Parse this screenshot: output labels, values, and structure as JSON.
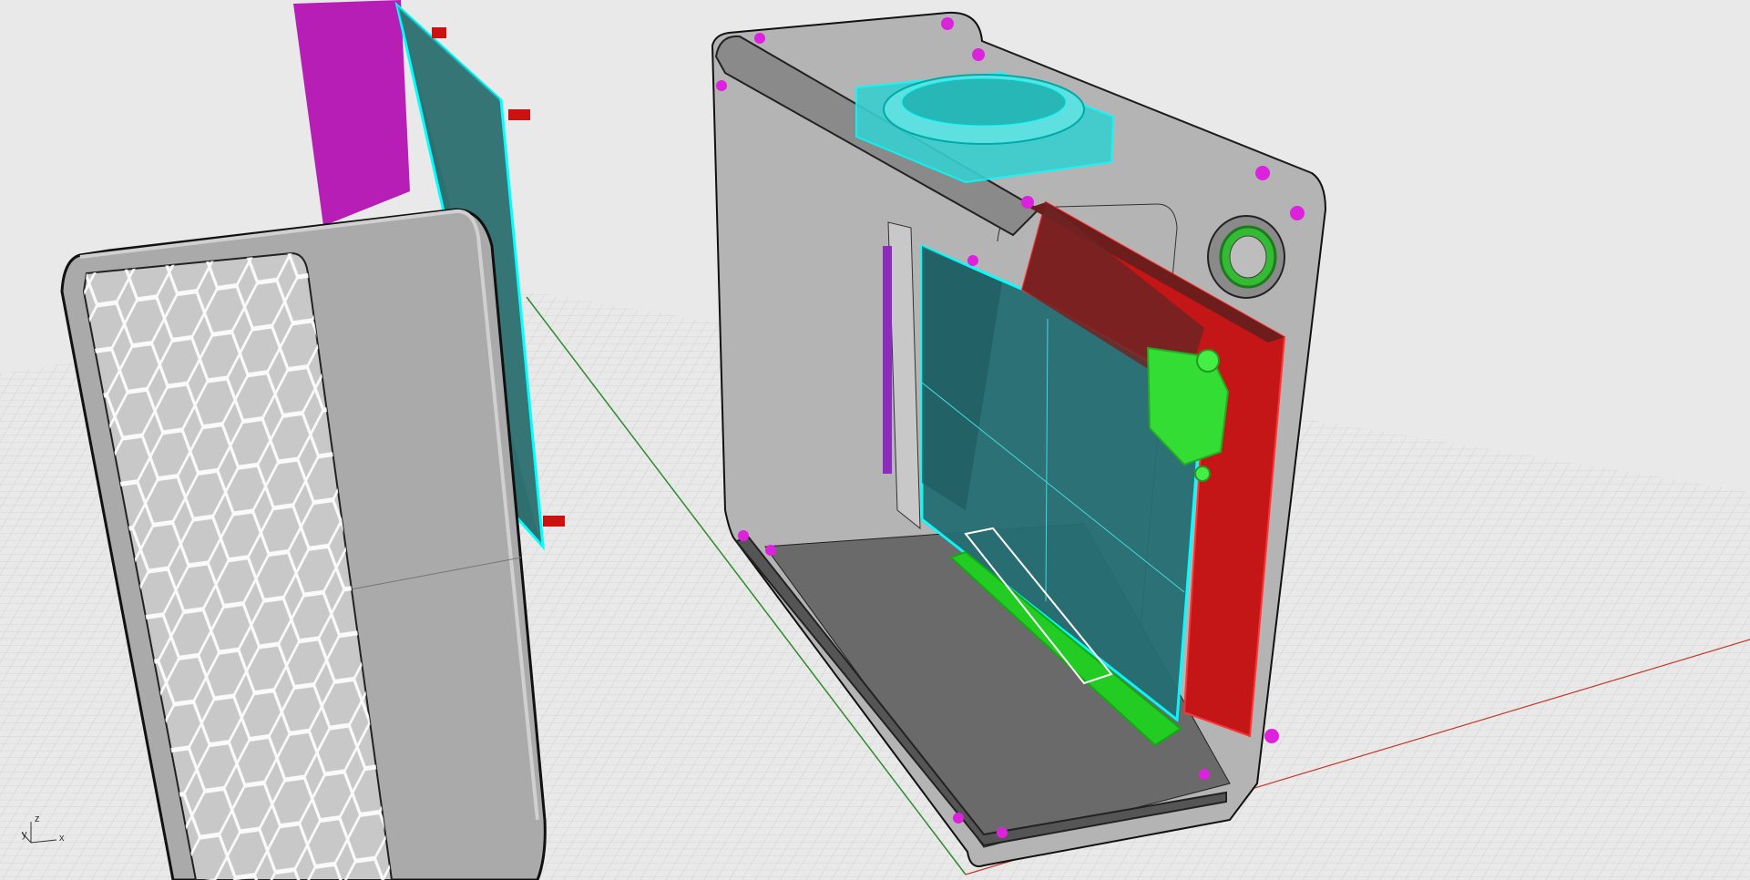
{
  "viewport": {
    "view": "perspective",
    "background_color": "#e9e9e9",
    "grid": true,
    "grid_color": "#c9c9c9",
    "x_axis_color": "#c0392b",
    "y_axis_color": "#2e8b2e"
  },
  "axis_widget": {
    "z_label": "z",
    "y_label": "y",
    "x_label": "x"
  },
  "colors": {
    "case_shell": "#b9b9b9",
    "case_floor": "#6a6a6a",
    "front_panel": "#aaaaaa",
    "mesh": "#ffffff",
    "gpu_board": "#256e72",
    "selection_highlight": "#00ffff",
    "psu": "#c41616",
    "pcie_riser": "#22cc22",
    "side_panel": "#b61eb6",
    "screws": "#dd22dd",
    "standoffs": "#cc1111",
    "power_button": "#33bb33"
  },
  "scene_objects": [
    "case-shell",
    "front-panel",
    "hex-mesh-grille",
    "side-panel",
    "motherboard-plate",
    "gpu-card",
    "psu",
    "fan",
    "pcie-riser",
    "power-button",
    "top-rail",
    "bottom-rail",
    "io-bracket",
    "connector"
  ]
}
